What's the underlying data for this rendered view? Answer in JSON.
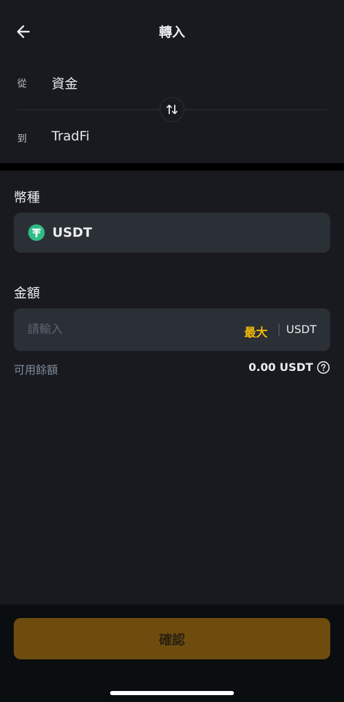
{
  "header": {
    "title": "轉入",
    "back_icon": "arrow-left-icon"
  },
  "transfer": {
    "from_label": "從",
    "from_value": "資金",
    "to_label": "到",
    "to_value": "TradFi",
    "swap_icon": "swap-vertical-icon"
  },
  "coin": {
    "label": "幣種",
    "selected": "USDT",
    "icon": "tether-icon",
    "icon_color": "#2ebd85"
  },
  "amount": {
    "label": "金額",
    "placeholder": "請輸入",
    "value": "",
    "max_label": "最大",
    "unit": "USDT"
  },
  "available": {
    "label": "可用餘額",
    "value": "0.00 USDT",
    "help_icon": "question-circle-icon"
  },
  "footer": {
    "confirm_label": "確認"
  },
  "colors": {
    "accent": "#f0b90b",
    "background": "#181a20",
    "panel": "#2b2f36",
    "disabled_button": "#6e4c0e"
  }
}
